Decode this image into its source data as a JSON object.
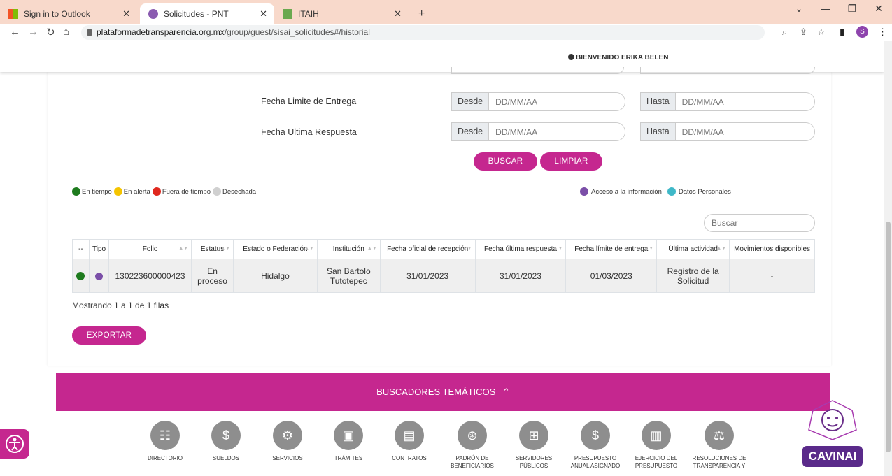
{
  "browser": {
    "tabs": [
      {
        "title": "Sign in to Outlook"
      },
      {
        "title": "Solicitudes - PNT"
      },
      {
        "title": "ITAIH"
      }
    ],
    "url_host": "plataformadetransparencia.org.mx",
    "url_path": "/group/guest/sisai_solicitudes#/historial",
    "profile_initial": "S"
  },
  "header": {
    "welcome": "BIENVENIDO ERIKA BELEN"
  },
  "filters": {
    "fecha_limite_label": "Fecha Limite de Entrega",
    "fecha_ultima_label": "Fecha Ultima Respuesta",
    "desde": "Desde",
    "hasta": "Hasta",
    "date_placeholder": "DD/MM/AA",
    "buscar": "BUSCAR",
    "limpiar": "LIMPIAR"
  },
  "legend": {
    "en_tiempo": "En tiempo",
    "en_alerta": "En alerta",
    "fuera_tiempo": "Fuera de tiempo",
    "desechada": "Desechada",
    "acceso": "Acceso a la información",
    "datos": "Datos Personales"
  },
  "colors": {
    "accent": "#c5278f",
    "green": "#1e7b1e",
    "yellow": "#f5c400",
    "red": "#e0281e",
    "gray": "#d0d0d0",
    "purple": "#7b4fa8",
    "teal": "#3fb8c8"
  },
  "table": {
    "search_placeholder": "Buscar",
    "headers": [
      "--",
      "Tipo",
      "Folio",
      "Estatus",
      "Estado o Federación",
      "Institución",
      "Fecha oficial de recepción",
      "Fecha última respuesta",
      "Fecha límite de entrega",
      "Última actividad",
      "Movimientos disponibles"
    ],
    "row": {
      "folio": "130223600000423",
      "estatus": "En proceso",
      "estado": "Hidalgo",
      "institucion": "San Bartolo Tutotepec",
      "fecha_recepcion": "31/01/2023",
      "fecha_respuesta": "31/01/2023",
      "fecha_limite": "01/03/2023",
      "actividad": "Registro de la Solicitud",
      "movimientos": "-"
    },
    "showing": "Mostrando 1 a 1 de 1 filas",
    "exportar": "EXPORTAR"
  },
  "footer": {
    "band_title": "BUSCADORES TEMÁTICOS",
    "icons": [
      {
        "label": "DIRECTORIO"
      },
      {
        "label": "SUELDOS"
      },
      {
        "label": "SERVICIOS"
      },
      {
        "label": "TRÁMITES"
      },
      {
        "label": "CONTRATOS"
      },
      {
        "label": "PADRÓN DE BENEFICIARIOS"
      },
      {
        "label": "SERVIDORES PÚBLICOS"
      },
      {
        "label": "PRESUPUESTO ANUAL ASIGNADO"
      },
      {
        "label": "EJERCICIO DEL PRESUPUESTO"
      },
      {
        "label": "RESOLUCIONES DE TRANSPARENCIA Y"
      }
    ],
    "logo_text": "CAVINAI"
  }
}
